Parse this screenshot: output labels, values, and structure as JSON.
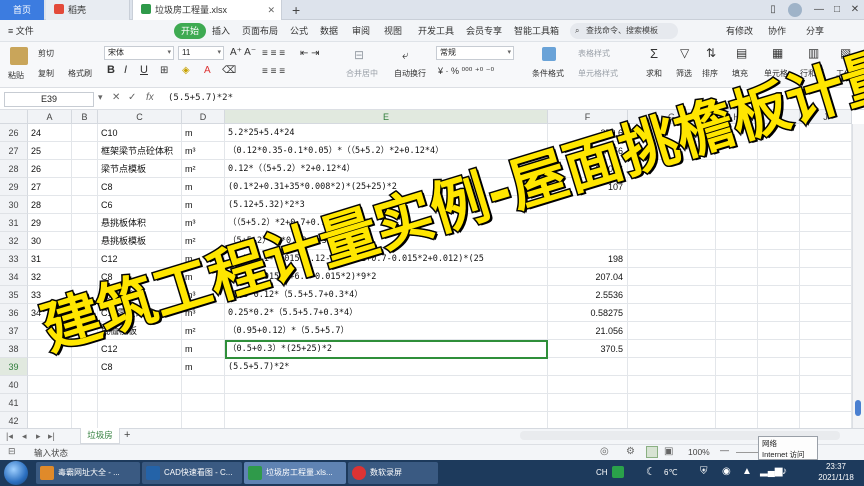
{
  "tabs": {
    "home": "首页",
    "doc": "稻壳",
    "active": "垃圾房工程量.xlsx",
    "new_tab": "+"
  },
  "window": {
    "minimize": "—",
    "maximize": "□",
    "close": "✕",
    "pin": "▯"
  },
  "menu": {
    "file": "≡ 文件",
    "items": [
      "开始",
      "插入",
      "页面布局",
      "公式",
      "数据",
      "审阅",
      "视图",
      "开发工具",
      "会员专享",
      "智能工具箱"
    ],
    "search": "查找命令、搜索模板",
    "right": [
      "有修改",
      "协作",
      "分享"
    ]
  },
  "ribbon": {
    "paste": "粘贴",
    "cut": "剪切",
    "copy": "复制",
    "format_painter": "格式刷",
    "font_name": "宋体",
    "font_size": "11",
    "bold": "B",
    "italic": "I",
    "underline": "U",
    "merge": "合并居中",
    "wrap": "自动换行",
    "number_format": "常规",
    "cond_format": "条件格式",
    "table_style": "表格样式",
    "cell_style": "单元格样式",
    "sum": "求和",
    "filter": "筛选",
    "sort": "排序",
    "fill": "填充",
    "cells": "单元格",
    "rowcol": "行和列",
    "worksheet": "工作表"
  },
  "formula_bar": {
    "name_box": "E39",
    "fx": "fx",
    "formula": "(5.5+5.7)*2*"
  },
  "columns": [
    "A",
    "B",
    "C",
    "D",
    "E",
    "F",
    "G",
    "H",
    "I",
    "J"
  ],
  "rows": [
    {
      "n": "26",
      "a": "24",
      "c": "C10",
      "d": "m",
      "e": "5.2*25+5.4*24",
      "f": "259.6"
    },
    {
      "n": "27",
      "a": "25",
      "c": "框架梁节点砼体积",
      "d": "m³",
      "e": "（0.12*0.35-0.1*0.05）*（（5+5.2）*2+0.12*4）",
      "f": "0.77256"
    },
    {
      "n": "28",
      "a": "26",
      "c": "梁节点模板",
      "d": "m²",
      "e": "0.12*（（5+5.2）*2+0.12*4）",
      "f": "2.5056"
    },
    {
      "n": "29",
      "a": "27",
      "c": "C8",
      "d": "m",
      "e": "(0.1*2+0.31+35*0.008*2)*(25+25)*2",
      "f": "107"
    },
    {
      "n": "30",
      "a": "28",
      "c": "C6",
      "d": "m",
      "e": "(5.12+5.32)*2*3",
      "f": ""
    },
    {
      "n": "31",
      "a": "29",
      "c": "悬挑板体积",
      "d": "m³",
      "e": "（（5+5.2）*2+0.7+0.7*4）*0.12",
      "f": ""
    },
    {
      "n": "32",
      "a": "30",
      "c": "悬挑板模板",
      "d": "m²",
      "e": "（5+5.2）*2*0.58+0.58*0.58*4",
      "f": ""
    },
    {
      "n": "33",
      "a": "31",
      "c": "C12",
      "d": "m",
      "e": "(0.7+0.1-0.015+0.12-0.015*2+0.7-0.015*2+0.012)*(25",
      "f": "198"
    },
    {
      "n": "34",
      "a": "32",
      "c": "C8",
      "d": "m",
      "e": "(6.4-0.015*2+6.6-0.015*2)*9*2",
      "f": "207.04"
    },
    {
      "n": "35",
      "a": "33",
      "c": "挑檐体积",
      "d": "m³",
      "e": "0.95*0.12*（5.5+5.7+0.3*4）",
      "f": "2.5536"
    },
    {
      "n": "36",
      "a": "34",
      "c": "C15零星砼",
      "d": "m³",
      "e": "0.25*0.2*（5.5+5.7+0.3*4）",
      "f": "0.58275"
    },
    {
      "n": "37",
      "a": "",
      "c": "挑檐模板",
      "d": "m²",
      "e": "（0.95+0.12）*（5.5+5.7）",
      "f": "21.056"
    },
    {
      "n": "38",
      "a": "",
      "c": "C12",
      "d": "m",
      "e": "（0.5+0.3）*(25+25)*2",
      "f": "370.5"
    },
    {
      "n": "39",
      "a": "",
      "c": "C8",
      "d": "m",
      "e": "(5.5+5.7)*2*",
      "f": ""
    },
    {
      "n": "40",
      "a": "",
      "c": "",
      "d": "",
      "e": "",
      "f": ""
    },
    {
      "n": "41",
      "a": "",
      "c": "",
      "d": "",
      "e": "",
      "f": ""
    },
    {
      "n": "42",
      "a": "",
      "c": "",
      "d": "",
      "e": "",
      "f": ""
    }
  ],
  "sheet": {
    "name": "垃圾房",
    "add": "+"
  },
  "status": {
    "mode": "输入状态",
    "zoom": "100%",
    "zoom_minus": "—",
    "zoom_plus": "+"
  },
  "tooltip": {
    "line1": "网络",
    "line2": "Internet 访问"
  },
  "taskbar": {
    "items": [
      "毒霸网址大全 - ...",
      "CAD快速看图 - C...",
      "垃圾房工程量.xls...",
      "数软录屏"
    ],
    "lang": "CH",
    "weather": "6℃",
    "time": "23:37",
    "date": "2021/1/18"
  },
  "overlay_title": "建筑工程计量实例-屋面挑檐板计量",
  "colors": {
    "accent_green": "#3eaa52",
    "home_tab": "#3c7ce0",
    "overlay_text": "#ffe600",
    "taskbar": "#1d3a5c"
  }
}
